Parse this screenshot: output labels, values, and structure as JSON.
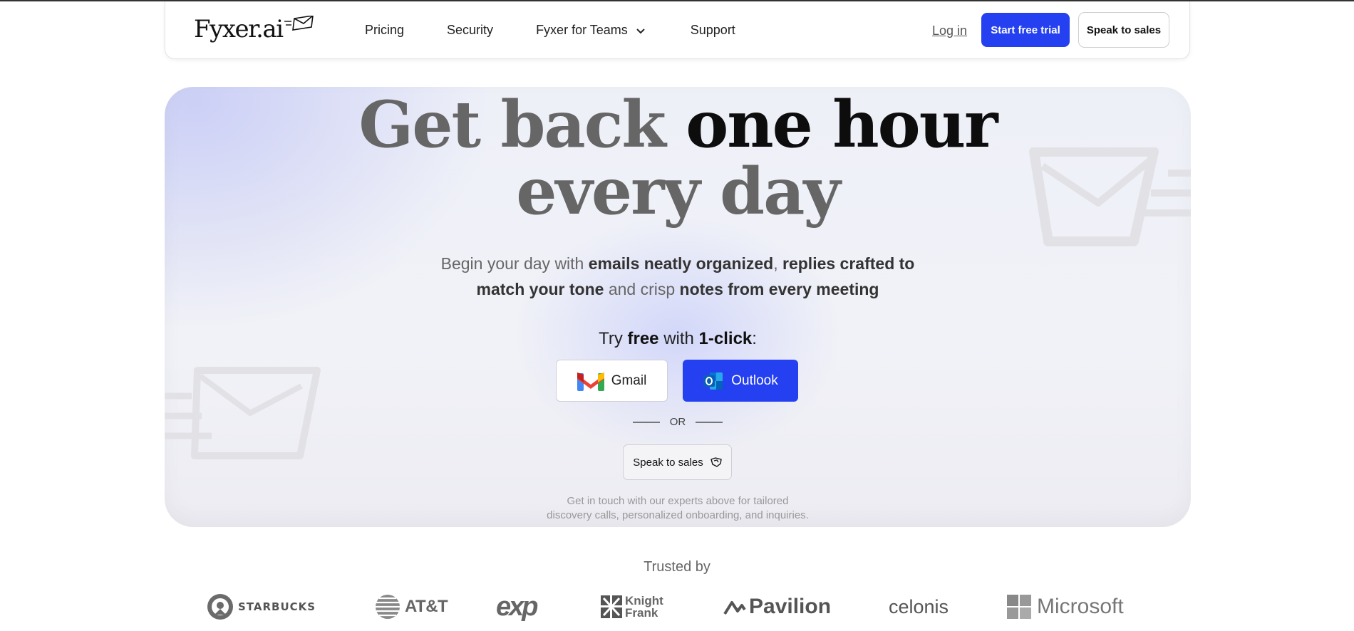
{
  "nav": {
    "logo": "Fyxer.ai",
    "links": [
      "Pricing",
      "Security",
      "Fyxer for Teams",
      "Support"
    ],
    "login": "Log in",
    "start_trial": "Start free trial",
    "speak_to_sales": "Speak to sales"
  },
  "hero": {
    "headline_light1": "Get back ",
    "headline_dark": "one hour",
    "headline_light2": "every day",
    "sub": {
      "p1": "Begin your day with ",
      "b1": "emails neatly organized",
      "p2": ", ",
      "b2": "replies crafted to match your tone",
      "p3": " and crisp ",
      "b3": "notes from every meeting"
    },
    "try": {
      "t1": "Try ",
      "b1": "free",
      "t2": " with ",
      "b2": "1-click",
      "t3": ":"
    },
    "gmail": "Gmail",
    "outlook": "Outlook",
    "or": "OR",
    "speak_to_sales": "Speak to sales",
    "note_line1": "Get in touch with our experts above for tailored",
    "note_line2": "discovery calls, personalized onboarding, and inquiries."
  },
  "trusted": {
    "title": "Trusted by",
    "brands": [
      "STARBUCKS",
      "AT&T",
      "exp",
      "Knight Frank",
      "Pavilion",
      "celonis",
      "Microsoft"
    ]
  },
  "colors": {
    "accent": "#2440f0"
  },
  "icons": [
    "chevron-down-icon",
    "gmail-icon",
    "outlook-icon",
    "handshake-icon",
    "envelope-icon"
  ]
}
